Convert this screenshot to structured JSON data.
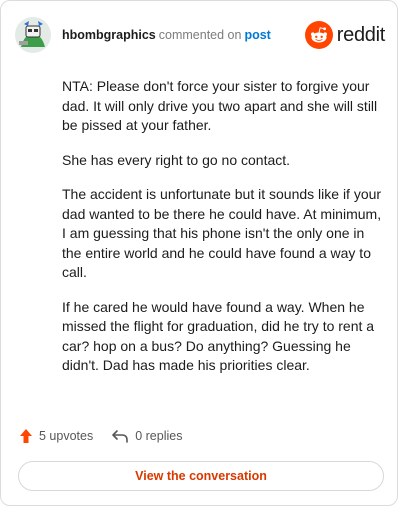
{
  "comment": {
    "username": "hbombgraphics",
    "action_text": "commented on",
    "target_link": "post",
    "paragraphs": [
      "NTA: Please don't force your sister to forgive your dad. It will only drive you two apart and she will still be pissed at your father.",
      "She has every right to go no contact.",
      "The accident is unfortunate but it sounds like if your dad wanted to be there he could have. At minimum, I am guessing that his phone isn't the only one in the entire world and he could have found a way to call.",
      "If he cared he would have found a way. When he missed the flight for graduation, did he try to rent a car? hop on a bus? Do anything? Guessing he didn't. Dad has made his priorities clear."
    ]
  },
  "brand": {
    "name": "reddit",
    "icon": "reddit-snoo-icon",
    "color": "#ff4500"
  },
  "stats": {
    "upvotes_label": "5 upvotes",
    "upvote_icon": "upvote-arrow-icon",
    "upvote_color": "#ff4500",
    "replies_label": "0 replies",
    "reply_icon": "reply-arrow-icon"
  },
  "actions": {
    "view_conversation_label": "View the conversation",
    "accent_color": "#d93900"
  }
}
